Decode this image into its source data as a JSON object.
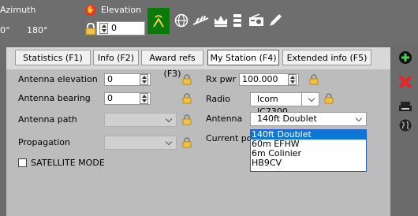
{
  "colors": {
    "top_bar": "#6e6e6e",
    "panel": "#bcbcbc",
    "accent_green": "#0b7a0b",
    "selection": "#0b78d6",
    "lock": "#f0c24a"
  },
  "top": {
    "azimuth_label": "Azimuth",
    "azimuth_values": [
      "0°",
      "180°"
    ],
    "elevation_label": "Elevation",
    "elevation_value": "0"
  },
  "tabs": [
    {
      "label": "Statistics (F1)"
    },
    {
      "label": "Info (F2)"
    },
    {
      "label": "Award refs (F3)"
    },
    {
      "label": "My Station (F4)",
      "active": true
    },
    {
      "label": "Extended info (F5)"
    }
  ],
  "form": {
    "antenna_elevation": {
      "label": "Antenna elevation",
      "value": "0"
    },
    "antenna_bearing": {
      "label": "Antenna bearing",
      "value": "0"
    },
    "antenna_path": {
      "label": "Antenna path",
      "value": ""
    },
    "propagation": {
      "label": "Propagation",
      "value": ""
    },
    "satellite_mode": {
      "label": "SATELLITE MODE",
      "checked": false
    },
    "rx_pwr": {
      "label": "Rx pwr",
      "value": "100.000"
    },
    "radio": {
      "label": "Radio",
      "value": "Icom IC7300"
    },
    "antenna": {
      "label": "Antenna",
      "value": "140ft Doublet"
    },
    "current_position": {
      "label": "Current po"
    }
  },
  "antenna_options": [
    "140ft Doublet",
    "60m EFHW",
    "6m Colinier",
    "HB9CV"
  ],
  "icons": {
    "toolbar": [
      "antenna-signal-icon",
      "globe-icon",
      "tower-icon",
      "crown-icon",
      "server-icon",
      "radio-icon",
      "pen-icon"
    ],
    "side": [
      "add-icon",
      "delete-icon",
      "printer-icon",
      "globe-icon"
    ]
  }
}
